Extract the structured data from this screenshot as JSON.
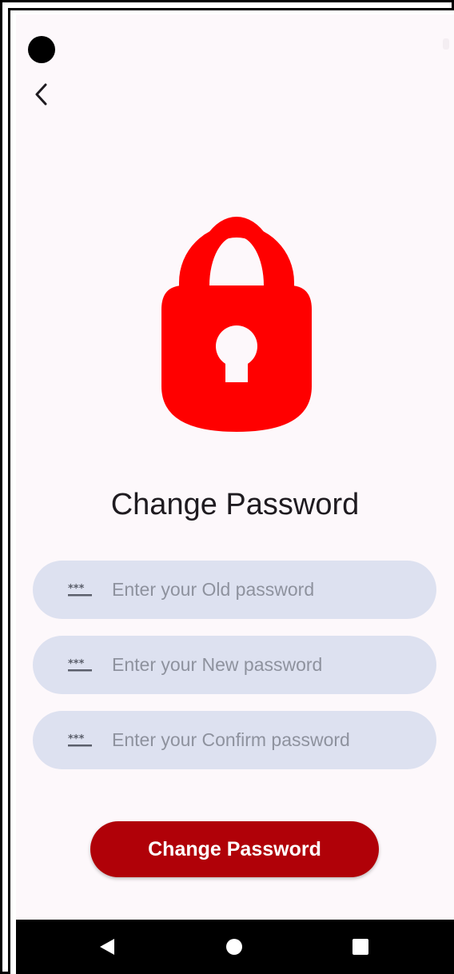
{
  "header": {
    "back_icon": "chevron-left-icon"
  },
  "hero": {
    "icon": "lock-icon",
    "color": "#ff0000"
  },
  "title": "Change Password",
  "fields": [
    {
      "icon": "password-icon",
      "placeholder": "Enter your Old password",
      "value": ""
    },
    {
      "icon": "password-icon",
      "placeholder": "Enter your New password",
      "value": ""
    },
    {
      "icon": "password-icon",
      "placeholder": "Enter your Confirm password",
      "value": ""
    }
  ],
  "submit": {
    "label": "Change Password",
    "color": "#b00108"
  },
  "navbar": {
    "back_icon": "triangle-back-icon",
    "home_icon": "circle-home-icon",
    "recents_icon": "square-recents-icon"
  }
}
